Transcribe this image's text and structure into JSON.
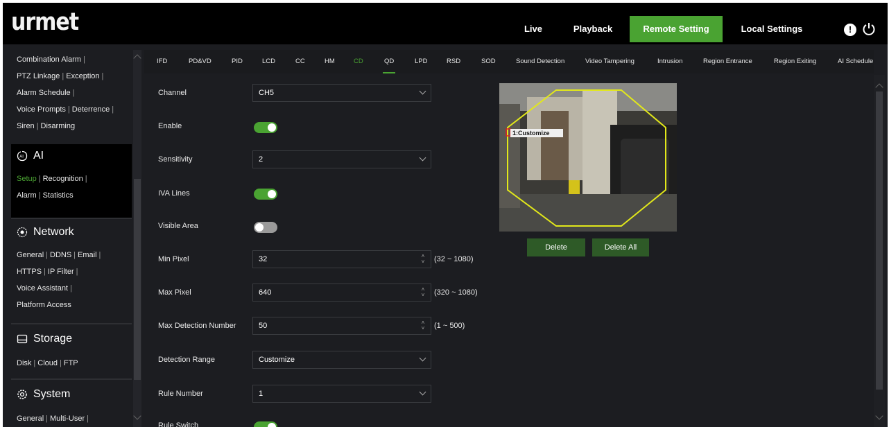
{
  "header": {
    "logo": "urmet",
    "nav": {
      "live": "Live",
      "playback": "Playback",
      "remote_setting": "Remote Setting",
      "local_settings": "Local Settings"
    },
    "info_glyph": "!",
    "accent_color": "#4aa332"
  },
  "sidebar": {
    "alarm_links": {
      "combination_alarm": "Combination Alarm",
      "ptz_linkage": "PTZ Linkage",
      "exception": "Exception",
      "alarm_schedule": "Alarm Schedule",
      "voice_prompts": "Voice Prompts",
      "deterrence": "Deterrence",
      "siren": "Siren",
      "disarming": "Disarming"
    },
    "ai": {
      "title": "AI",
      "setup": "Setup",
      "recognition": "Recognition",
      "alarm": "Alarm",
      "statistics": "Statistics"
    },
    "network": {
      "title": "Network",
      "general": "General",
      "ddns": "DDNS",
      "email": "Email",
      "https": "HTTPS",
      "ip_filter": "IP Filter",
      "voice_assistant": "Voice Assistant",
      "platform_access": "Platform Access"
    },
    "storage": {
      "title": "Storage",
      "disk": "Disk",
      "cloud": "Cloud",
      "ftp": "FTP"
    },
    "system": {
      "title": "System",
      "general": "General",
      "multi_user": "Multi-User"
    },
    "separator": "|"
  },
  "tabs": [
    "IFD",
    "PD&VD",
    "PID",
    "LCD",
    "CC",
    "HM",
    "CD",
    "QD",
    "LPD",
    "RSD",
    "SOD",
    "Sound Detection",
    "Video Tampering",
    "Intrusion",
    "Region Entrance",
    "Region Exiting",
    "AI Schedule"
  ],
  "form": {
    "channel": {
      "label": "Channel",
      "value": "CH5"
    },
    "enable": {
      "label": "Enable",
      "on": true
    },
    "sensitivity": {
      "label": "Sensitivity",
      "value": "2"
    },
    "iva_lines": {
      "label": "IVA Lines",
      "on": true
    },
    "visible_area": {
      "label": "Visible Area",
      "on": false
    },
    "min_pixel": {
      "label": "Min Pixel",
      "value": "32",
      "range": "(32 ~ 1080)"
    },
    "max_pixel": {
      "label": "Max Pixel",
      "value": "640",
      "range": "(320 ~ 1080)"
    },
    "max_detection_number": {
      "label": "Max Detection Number",
      "value": "50",
      "range": "(1 ~ 500)"
    },
    "detection_range": {
      "label": "Detection Range",
      "value": "Customize"
    },
    "rule_number": {
      "label": "Rule Number",
      "value": "1"
    },
    "rule_switch": {
      "label": "Rule Switch",
      "on": true
    }
  },
  "preview": {
    "region_label": "1:Customize",
    "delete": "Delete",
    "delete_all": "Delete All"
  }
}
